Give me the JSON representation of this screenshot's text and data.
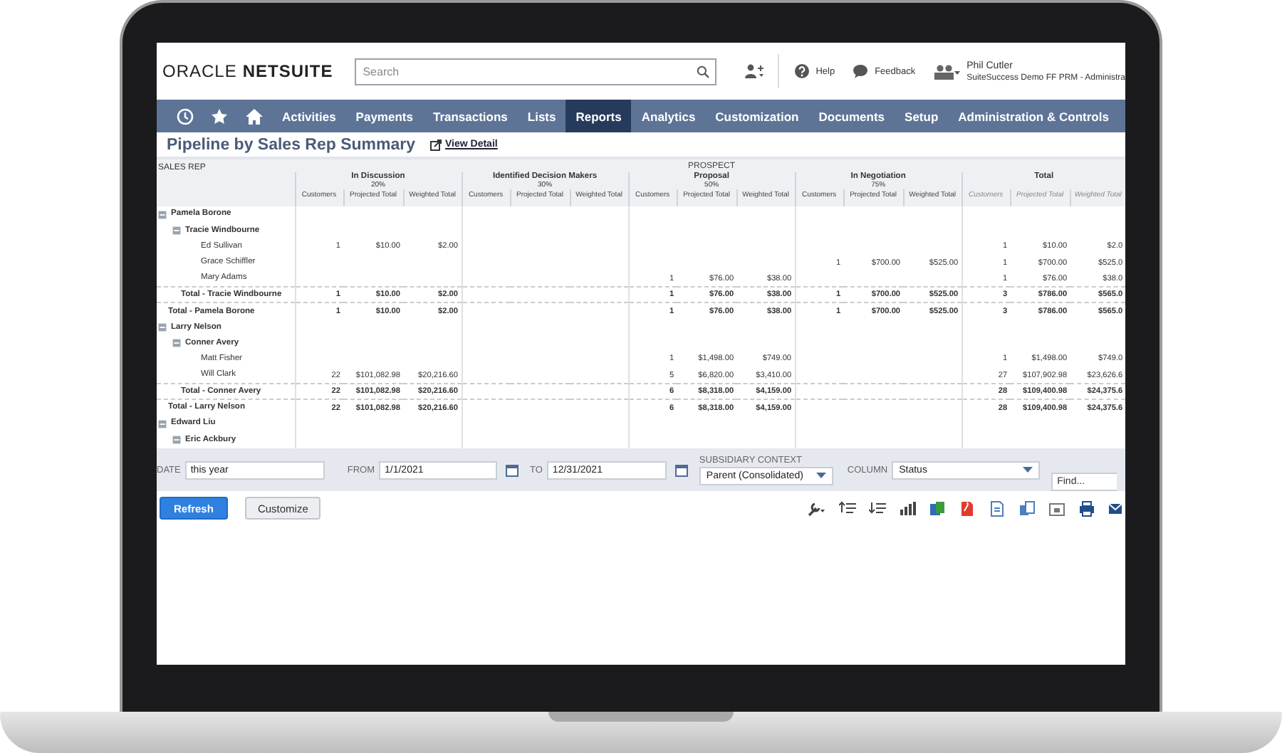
{
  "header": {
    "logo": {
      "brand": "ORACLE",
      "product": "NETSUITE"
    },
    "search": {
      "placeholder": "Search"
    },
    "help": "Help",
    "feedback": "Feedback",
    "user": {
      "name": "Phil Cutler",
      "role": "SuiteSuccess Demo FF PRM - Administra"
    }
  },
  "nav": {
    "items": [
      {
        "label": "Activities",
        "selected": false
      },
      {
        "label": "Payments",
        "selected": false
      },
      {
        "label": "Transactions",
        "selected": false
      },
      {
        "label": "Lists",
        "selected": false
      },
      {
        "label": "Reports",
        "selected": true
      },
      {
        "label": "Analytics",
        "selected": false
      },
      {
        "label": "Customization",
        "selected": false
      },
      {
        "label": "Documents",
        "selected": false
      },
      {
        "label": "Setup",
        "selected": false
      },
      {
        "label": "Administration & Controls",
        "selected": false
      }
    ]
  },
  "page": {
    "title": "Pipeline by Sales Rep Summary",
    "link": "View Detail"
  },
  "table": {
    "row_header": "SALES REP",
    "groups": [
      {
        "label": "In Discussion",
        "percent": "20%",
        "kind": "stage",
        "columns": [
          "Customers",
          "Projected Total",
          "Weighted Total"
        ]
      },
      {
        "label": "Identified Decision Makers",
        "percent": "30%",
        "kind": "stage",
        "columns": [
          "Customers",
          "Projected Total",
          "Weighted Total"
        ]
      },
      {
        "category": "PROSPECT",
        "label": "Proposal",
        "percent": "50%",
        "kind": "stage",
        "columns": [
          "Customers",
          "Projected Total",
          "Weighted Total"
        ]
      },
      {
        "label": "In Negotiation",
        "percent": "75%",
        "kind": "stage",
        "columns": [
          "Customers",
          "Projected Total",
          "Weighted Total"
        ]
      },
      {
        "label": "Total",
        "kind": "total",
        "columns": [
          "Customers",
          "Projected Total",
          "Weighted Total"
        ]
      }
    ],
    "rows": [
      {
        "name": "Pamela Borone",
        "expanded": true,
        "children": [
          {
            "name": "Tracie Windbourne",
            "expanded": true,
            "children": [
              {
                "name": "Ed Sullivan",
                "cells": {
                  "in_discussion": [
                    "1",
                    "$10.00",
                    "$2.00"
                  ],
                  "total": [
                    "1",
                    "$10.00",
                    "$2.0"
                  ]
                }
              },
              {
                "name": "Grace Schiffler",
                "cells": {
                  "in_negotiation": [
                    "1",
                    "$700.00",
                    "$525.00"
                  ],
                  "total": [
                    "1",
                    "$700.00",
                    "$525.0"
                  ]
                }
              },
              {
                "name": "Mary Adams",
                "cells": {
                  "proposal": [
                    "1",
                    "$76.00",
                    "$38.00"
                  ],
                  "total": [
                    "1",
                    "$76.00",
                    "$38.0"
                  ]
                }
              }
            ],
            "total": {
              "label": "Total - Tracie Windbourne",
              "cells": {
                "in_discussion": [
                  "1",
                  "$10.00",
                  "$2.00"
                ],
                "proposal": [
                  "1",
                  "$76.00",
                  "$38.00"
                ],
                "in_negotiation": [
                  "1",
                  "$700.00",
                  "$525.00"
                ],
                "total": [
                  "3",
                  "$786.00",
                  "$565.0"
                ]
              }
            }
          }
        ],
        "total": {
          "label": "Total - Pamela Borone",
          "cells": {
            "in_discussion": [
              "1",
              "$10.00",
              "$2.00"
            ],
            "proposal": [
              "1",
              "$76.00",
              "$38.00"
            ],
            "in_negotiation": [
              "1",
              "$700.00",
              "$525.00"
            ],
            "total": [
              "3",
              "$786.00",
              "$565.0"
            ]
          }
        }
      },
      {
        "name": "Larry Nelson",
        "expanded": true,
        "children": [
          {
            "name": "Conner Avery",
            "expanded": true,
            "children": [
              {
                "name": "Matt Fisher",
                "cells": {
                  "proposal": [
                    "1",
                    "$1,498.00",
                    "$749.00"
                  ],
                  "total": [
                    "1",
                    "$1,498.00",
                    "$749.0"
                  ]
                }
              },
              {
                "name": "Will Clark",
                "cells": {
                  "in_discussion": [
                    "22",
                    "$101,082.98",
                    "$20,216.60"
                  ],
                  "proposal": [
                    "5",
                    "$6,820.00",
                    "$3,410.00"
                  ],
                  "total": [
                    "27",
                    "$107,902.98",
                    "$23,626.6"
                  ]
                }
              }
            ],
            "total": {
              "label": "Total - Conner Avery",
              "cells": {
                "in_discussion": [
                  "22",
                  "$101,082.98",
                  "$20,216.60"
                ],
                "proposal": [
                  "6",
                  "$8,318.00",
                  "$4,159.00"
                ],
                "total": [
                  "28",
                  "$109,400.98",
                  "$24,375.6"
                ]
              }
            }
          }
        ],
        "total": {
          "label": "Total - Larry Nelson",
          "cells": {
            "in_discussion": [
              "22",
              "$101,082.98",
              "$20,216.60"
            ],
            "proposal": [
              "6",
              "$8,318.00",
              "$4,159.00"
            ],
            "total": [
              "28",
              "$109,400.98",
              "$24,375.6"
            ]
          }
        }
      },
      {
        "name": "Edward Liu",
        "expanded": true,
        "children": [
          {
            "name": "Eric Ackbury",
            "expanded": true
          }
        ]
      }
    ]
  },
  "filters": {
    "date": {
      "label": "DATE",
      "value": "this year"
    },
    "from": {
      "label": "FROM",
      "value": "1/1/2021"
    },
    "to": {
      "label": "TO",
      "value": "12/31/2021"
    },
    "subsidiary": {
      "label": "SUBSIDIARY CONTEXT",
      "value": "Parent (Consolidated)"
    },
    "column": {
      "label": "COLUMN",
      "value": "Status"
    },
    "find": {
      "placeholder": "Find..."
    }
  },
  "buttons": [
    {
      "label": "Refresh",
      "kind": "primary"
    },
    {
      "label": "Customize",
      "kind": "secondary"
    }
  ]
}
